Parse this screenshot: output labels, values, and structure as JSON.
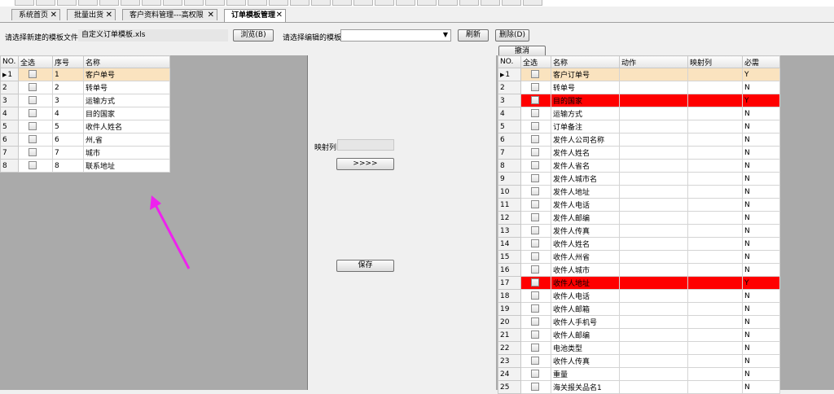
{
  "tabs": [
    {
      "label": "系统首页",
      "close": "✕"
    },
    {
      "label": "批量出货",
      "close": "✕"
    },
    {
      "label": "客户资料管理---高权限",
      "close": "✕"
    },
    {
      "label": "订单模板管理",
      "close": "✕"
    }
  ],
  "toolbar": {
    "new_template_label": "请选择新建的模板文件",
    "file_value": "自定义订单模板.xls",
    "browse_button": "浏览(B)",
    "edit_template_label": "请选择编辑的模板",
    "edit_template_value": "",
    "refresh_button": "刷新",
    "delete_button": "删除(D)",
    "cancel_button": "撤消"
  },
  "left_grid": {
    "headers": {
      "no": "NO.",
      "select_all": "全选",
      "seq": "序号",
      "name": "名称"
    },
    "rows": [
      {
        "no": "1",
        "seq": "1",
        "name": "客户单号"
      },
      {
        "no": "2",
        "seq": "2",
        "name": "转单号"
      },
      {
        "no": "3",
        "seq": "3",
        "name": "运输方式"
      },
      {
        "no": "4",
        "seq": "4",
        "name": "目的国家"
      },
      {
        "no": "5",
        "seq": "5",
        "name": "收件人姓名"
      },
      {
        "no": "6",
        "seq": "6",
        "name": "州,省"
      },
      {
        "no": "7",
        "seq": "7",
        "name": "城市"
      },
      {
        "no": "8",
        "seq": "8",
        "name": "联系地址"
      }
    ]
  },
  "middle": {
    "mapping_label": "映射列",
    "mapping_value": "",
    "transfer_button": ">>>>",
    "save_button": "保存"
  },
  "right_grid": {
    "headers": {
      "no": "NO.",
      "select_all": "全选",
      "name": "名称",
      "action": "动作",
      "mapping": "映射列",
      "required": "必需"
    },
    "rows": [
      {
        "no": "1",
        "name": "客户订单号",
        "action": "",
        "mapping": "",
        "required": "Y"
      },
      {
        "no": "2",
        "name": "转单号",
        "action": "",
        "mapping": "",
        "required": "N"
      },
      {
        "no": "3",
        "name": "目的国家",
        "action": "",
        "mapping": "",
        "required": "Y"
      },
      {
        "no": "4",
        "name": "运输方式",
        "action": "",
        "mapping": "",
        "required": "N"
      },
      {
        "no": "5",
        "name": "订单备注",
        "action": "",
        "mapping": "",
        "required": "N"
      },
      {
        "no": "6",
        "name": "发件人公司名称",
        "action": "",
        "mapping": "",
        "required": "N"
      },
      {
        "no": "7",
        "name": "发件人姓名",
        "action": "",
        "mapping": "",
        "required": "N"
      },
      {
        "no": "8",
        "name": "发件人省名",
        "action": "",
        "mapping": "",
        "required": "N"
      },
      {
        "no": "9",
        "name": "发件人城市名",
        "action": "",
        "mapping": "",
        "required": "N"
      },
      {
        "no": "10",
        "name": "发件人地址",
        "action": "",
        "mapping": "",
        "required": "N"
      },
      {
        "no": "11",
        "name": "发件人电话",
        "action": "",
        "mapping": "",
        "required": "N"
      },
      {
        "no": "12",
        "name": "发件人邮编",
        "action": "",
        "mapping": "",
        "required": "N"
      },
      {
        "no": "13",
        "name": "发件人传真",
        "action": "",
        "mapping": "",
        "required": "N"
      },
      {
        "no": "14",
        "name": "收件人姓名",
        "action": "",
        "mapping": "",
        "required": "N"
      },
      {
        "no": "15",
        "name": "收件人州省",
        "action": "",
        "mapping": "",
        "required": "N"
      },
      {
        "no": "16",
        "name": "收件人城市",
        "action": "",
        "mapping": "",
        "required": "N"
      },
      {
        "no": "17",
        "name": "收件人地址",
        "action": "",
        "mapping": "",
        "required": "Y"
      },
      {
        "no": "18",
        "name": "收件人电话",
        "action": "",
        "mapping": "",
        "required": "N"
      },
      {
        "no": "19",
        "name": "收件人邮箱",
        "action": "",
        "mapping": "",
        "required": "N"
      },
      {
        "no": "20",
        "name": "收件人手机号",
        "action": "",
        "mapping": "",
        "required": "N"
      },
      {
        "no": "21",
        "name": "收件人邮编",
        "action": "",
        "mapping": "",
        "required": "N"
      },
      {
        "no": "22",
        "name": "电池类型",
        "action": "",
        "mapping": "",
        "required": "N"
      },
      {
        "no": "23",
        "name": "收件人传真",
        "action": "",
        "mapping": "",
        "required": "N"
      },
      {
        "no": "24",
        "name": "重量",
        "action": "",
        "mapping": "",
        "required": "N"
      },
      {
        "no": "25",
        "name": "海关报关品名1",
        "action": "",
        "mapping": "",
        "required": "N"
      }
    ]
  },
  "colors": {
    "selected_row": "#fae3bf",
    "required_row": "#ff0000",
    "pane_background": "#aaaaaa",
    "arrow": "#ee22ee"
  },
  "icons": {
    "row_pointer": "row-pointer-icon",
    "arrow": "arrow-annotation-icon",
    "dropdown": "chevron-down-icon"
  }
}
